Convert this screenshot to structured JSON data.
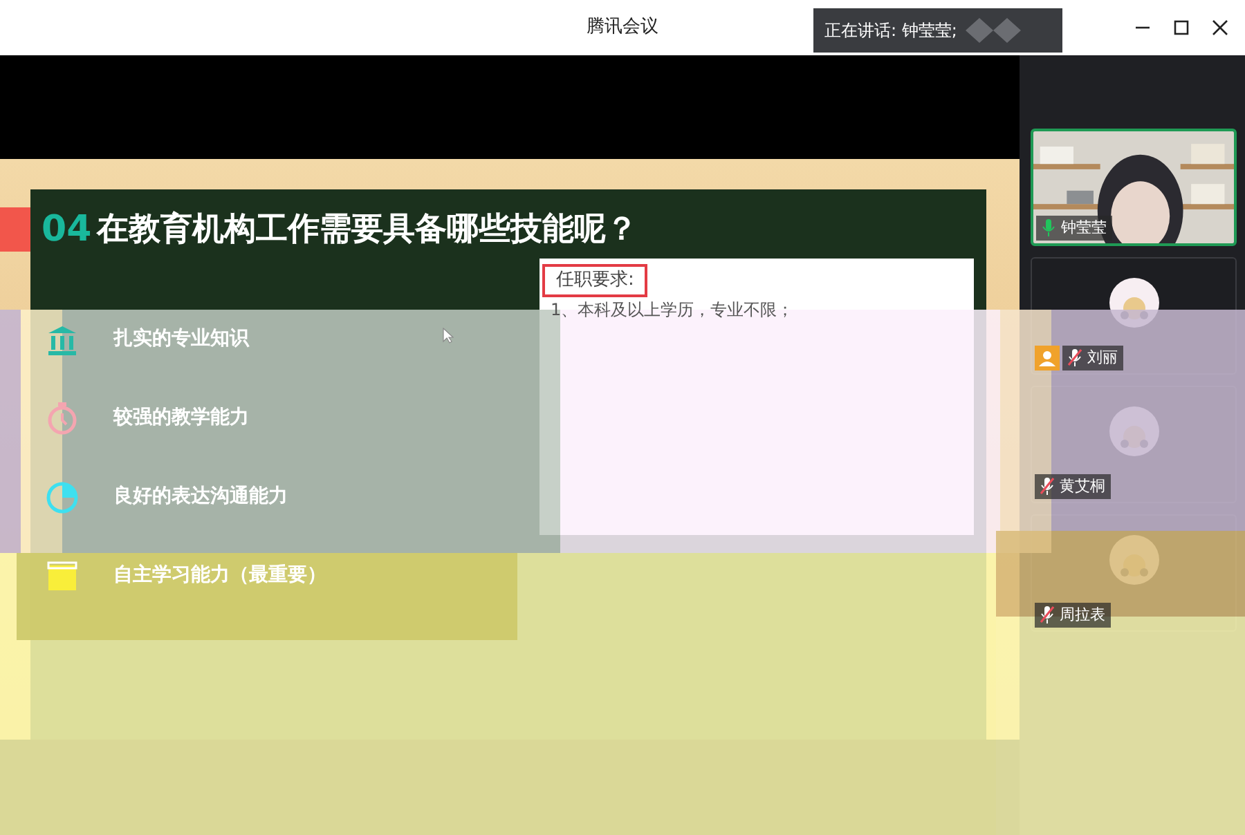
{
  "window": {
    "title": "腾讯会议"
  },
  "speaking_banner": {
    "text": "正在讲话: 钟莹莹;"
  },
  "slide": {
    "number": "04",
    "title": "在教育机构工作需要具备哪些技能呢？",
    "skills": [
      {
        "label": "扎实的专业知识",
        "kind": "bank"
      },
      {
        "label": "较强的教学能力",
        "kind": "clock"
      },
      {
        "label": "良好的表达沟通能力",
        "kind": "pie"
      },
      {
        "label": "自主学习能力（最重要）",
        "kind": "calendar"
      }
    ],
    "requirements": {
      "heading": "任职要求:",
      "lines": [
        "1、本科及以上学历，专业不限；"
      ]
    }
  },
  "participants": [
    {
      "name": "钟莹莹",
      "kind": "camera",
      "speaking": true,
      "muted": false,
      "host": false
    },
    {
      "name": "刘丽",
      "kind": "avatar",
      "speaking": false,
      "muted": true,
      "host": true
    },
    {
      "name": "黄艾桐",
      "kind": "avatar",
      "speaking": false,
      "muted": true,
      "host": false
    },
    {
      "name": "周拉表",
      "kind": "avatar",
      "speaking": false,
      "muted": true,
      "host": false
    }
  ]
}
